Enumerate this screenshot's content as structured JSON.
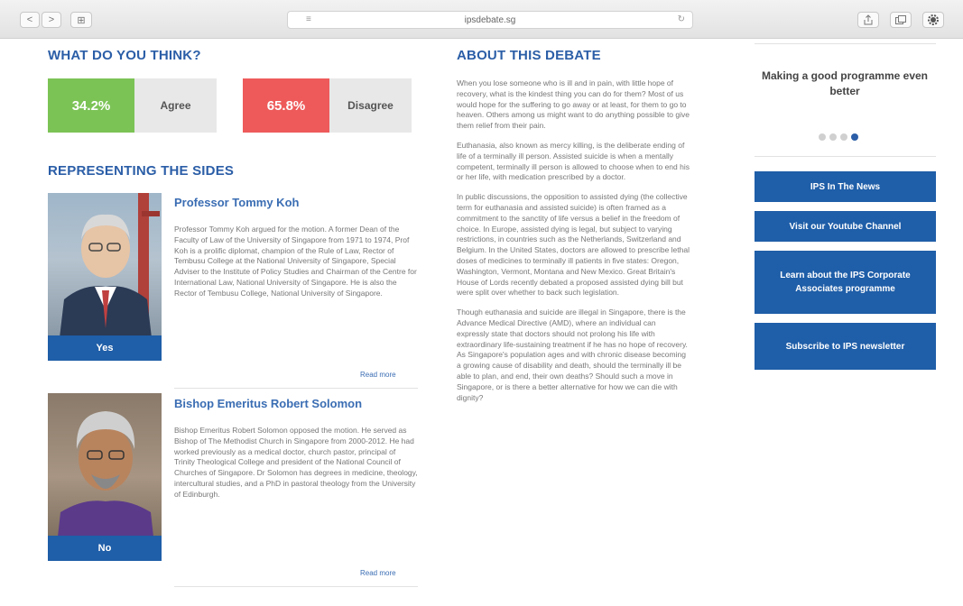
{
  "browser": {
    "url": "ipsdebate.sg",
    "back": "<",
    "forward": ">",
    "sidebar_toggle": "⊞",
    "reader": "≡",
    "reload": "↻"
  },
  "vote": {
    "heading": "WHAT DO YOU THINK?",
    "agree": {
      "pct": "34.2%",
      "label": "Agree",
      "color": "#7cc356"
    },
    "disagree": {
      "pct": "65.8%",
      "label": "Disagree",
      "color": "#ee5a5a"
    }
  },
  "sides": {
    "heading": "REPRESENTING THE SIDES",
    "profiles": [
      {
        "name": "Professor Tommy Koh",
        "stance": "Yes",
        "bio": "Professor Tommy Koh argued for the motion. A former Dean of the Faculty of Law of the University of Singapore from 1971 to 1974, Prof Koh is a prolific diplomat, champion of the Rule of Law, Rector of Tembusu College at the National University of Singapore, Special Adviser to the Institute of Policy Studies and Chairman of the Centre for International Law, National University of Singapore. He is also the Rector of Tembusu College, National University of Singapore.",
        "read_more": "Read more"
      },
      {
        "name": "Bishop Emeritus Robert Solomon",
        "stance": "No",
        "bio": "Bishop Emeritus Robert Solomon opposed the motion. He served as Bishop of The Methodist Church in Singapore from 2000-2012. He had worked previously as a medical doctor, church pastor, principal of Trinity Theological College and president of the National Council of Churches of Singapore. Dr Solomon has degrees in medicine, theology, intercultural studies, and a PhD in pastoral theology from the University of Edinburgh.",
        "read_more": "Read more"
      }
    ]
  },
  "about": {
    "heading": "ABOUT THIS DEBATE",
    "paragraphs": [
      "When you lose someone who is ill and in pain, with little hope of recovery, what is the kindest thing you can do for them? Most of us would hope for the suffering to go away or at least, for them to go to heaven. Others among us might want to do anything possible to give them relief from their pain.",
      "Euthanasia, also known as mercy killing, is the deliberate ending of life of a terminally ill person. Assisted suicide is when a mentally competent, terminally ill person is allowed to choose when to end his or her life, with medication prescribed by a doctor.",
      "In public discussions, the opposition to assisted dying (the collective term for euthanasia and assisted suicide) is often framed as a commitment to the sanctity of life versus a belief in the freedom of choice. In Europe, assisted dying is legal, but subject to varying restrictions, in countries such as the Netherlands, Switzerland and Belgium. In the United States, doctors are allowed to prescribe lethal doses of medicines to terminally ill patients in five states: Oregon, Washington, Vermont, Montana and New Mexico. Great Britain's House of Lords recently debated a proposed assisted dying bill but were split over whether to back such legislation.",
      "Though euthanasia and suicide are illegal in Singapore, there is the Advance Medical Directive (AMD), where an individual can expressly state that doctors should not prolong his life with extraordinary life-sustaining treatment if he has no hope of recovery. As Singapore's population ages and with chronic disease becoming a growing cause of disability and death, should the terminally ill be able to plan, and end, their own deaths? Should such a move in Singapore, or is there a better alternative for how we can die with dignity?"
    ]
  },
  "sidebar": {
    "carousel_title": "Making a good programme even better",
    "dots": 4,
    "active_dot": 3,
    "buttons": [
      "IPS In The News",
      "Visit our Youtube Channel",
      "Learn about the IPS Corporate Associates programme",
      "Subscribe to IPS newsletter"
    ]
  },
  "colors": {
    "heading_blue": "#2b5ea7",
    "button_blue": "#1f5ea8"
  }
}
